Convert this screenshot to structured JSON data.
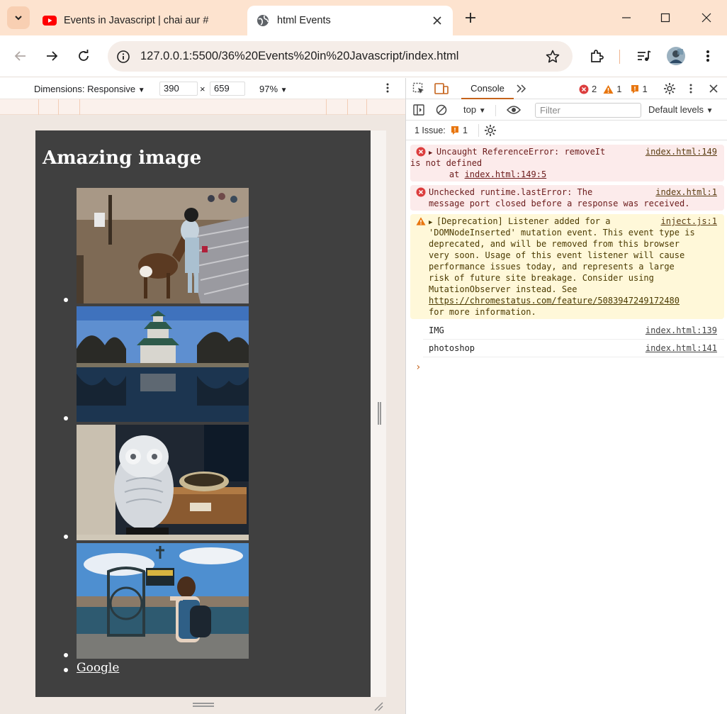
{
  "browser": {
    "tabs": [
      {
        "title": "Events in Javascript | chai aur #",
        "favicon": "youtube-icon"
      },
      {
        "title": "html Events",
        "favicon": "globe-icon"
      }
    ],
    "url": "127.0.0.1:5500/36%20Events%20in%20Javascript/index.html"
  },
  "device_toolbar": {
    "dimensions_label": "Dimensions: Responsive",
    "width": "390",
    "times": "×",
    "height": "659",
    "zoom": "97%"
  },
  "page": {
    "heading": "Amazing image",
    "images": [
      {
        "alt": "child feeding deer"
      },
      {
        "alt": "castle reflected in pond"
      },
      {
        "alt": "white owl figurine"
      },
      {
        "alt": "woman at bridge railing"
      }
    ],
    "link": "Google"
  },
  "devtools": {
    "tab": "Console",
    "error_count": "2",
    "warning_count": "1",
    "issue_count": "1",
    "context": "top",
    "filter_placeholder": "Filter",
    "levels": "Default levels",
    "issues_label": "1 Issue:",
    "issues_count": "1",
    "messages": [
      {
        "type": "error",
        "line1": "Uncaught ReferenceError: removeIt",
        "line2": "is not defined",
        "line3": "    at ",
        "line3_link": "index.html:149:5",
        "source": "index.html:149"
      },
      {
        "type": "error",
        "line1": "Unchecked runtime.lastError: The",
        "line2": "message port closed before a response was received.",
        "source": "index.html:1"
      },
      {
        "type": "warning",
        "line1": "[Deprecation] Listener added for a",
        "line2": "'DOMNodeInserted' mutation event. This event type is",
        "line3": "deprecated, and will be removed from this browser",
        "line4": "very soon. Usage of this event listener will cause",
        "line5": "performance issues today, and represents a large",
        "line6": "risk of future site breakage. Consider using",
        "line7": "MutationObserver instead. See",
        "line8_link": "https://chromestatus.com/feature/5083947249172480",
        "line9": "for more information.",
        "source": "inject.js:1"
      },
      {
        "type": "log",
        "text": "IMG",
        "source": "index.html:139"
      },
      {
        "type": "log",
        "text": "photoshop",
        "source": "index.html:141"
      }
    ],
    "prompt": "›"
  },
  "colors": {
    "titlebar": "#fde3cf",
    "accent": "#c5631b",
    "page_bg": "#404040",
    "error_bg": "#fcebeb",
    "warning_bg": "#fff8d9"
  }
}
